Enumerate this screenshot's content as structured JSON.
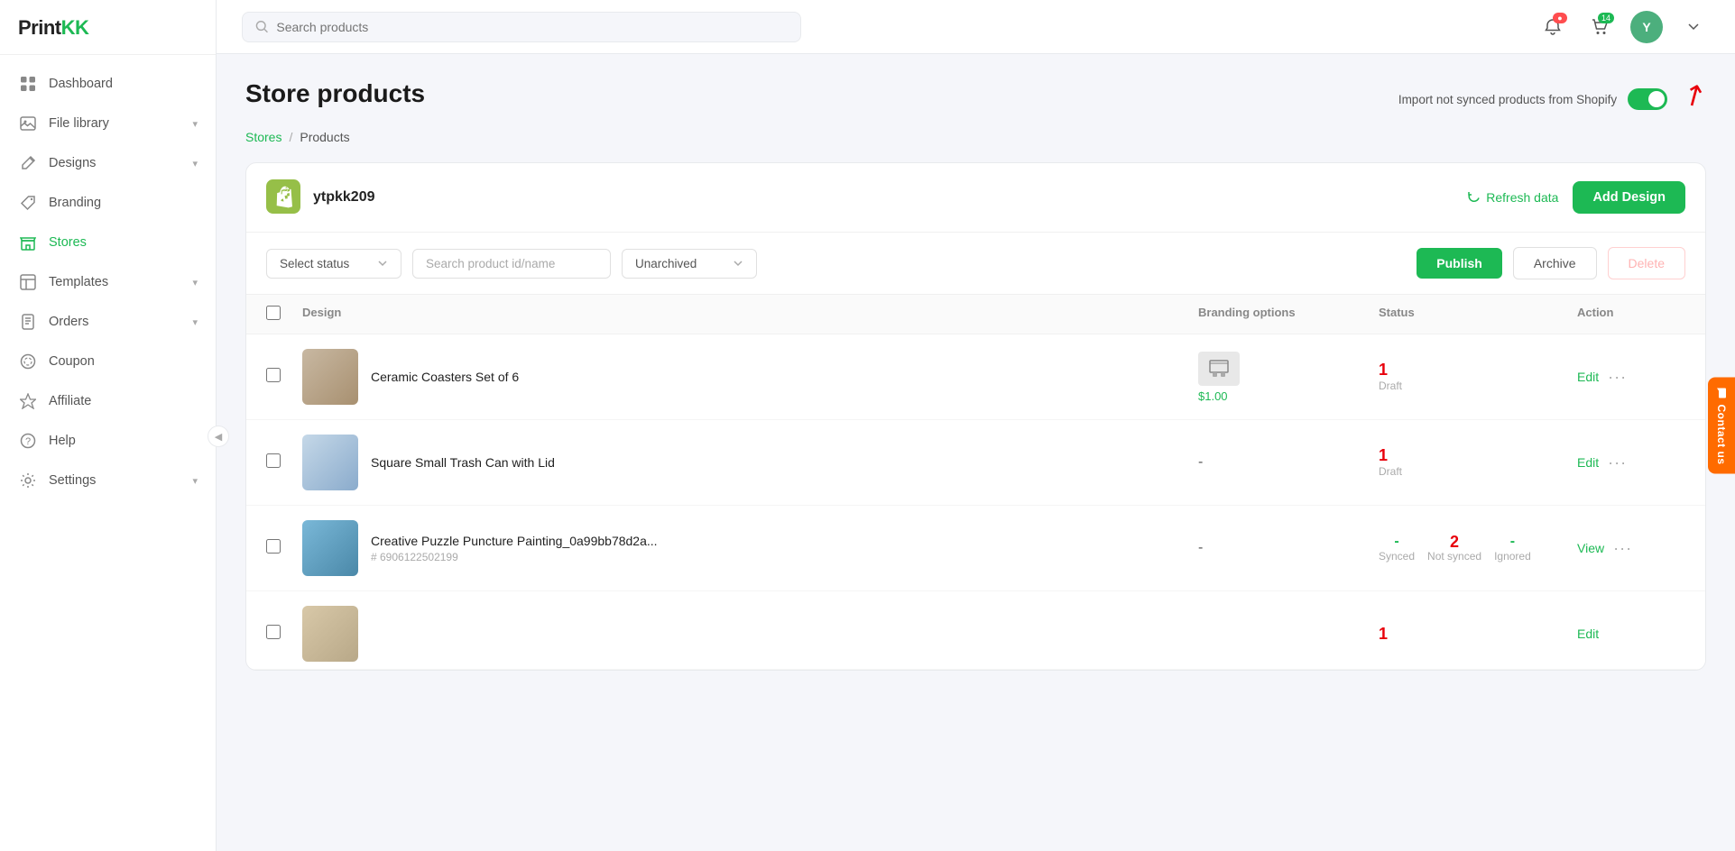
{
  "sidebar": {
    "logo": {
      "print": "Print",
      "kk": "KK"
    },
    "items": [
      {
        "id": "dashboard",
        "label": "Dashboard",
        "icon": "grid",
        "hasArrow": false
      },
      {
        "id": "file-library",
        "label": "File library",
        "icon": "image",
        "hasArrow": true
      },
      {
        "id": "designs",
        "label": "Designs",
        "icon": "pen",
        "hasArrow": true
      },
      {
        "id": "branding",
        "label": "Branding",
        "icon": "tag",
        "hasArrow": false
      },
      {
        "id": "stores",
        "label": "Stores",
        "icon": "store",
        "hasArrow": false,
        "active": true
      },
      {
        "id": "templates",
        "label": "Templates",
        "icon": "template",
        "hasArrow": true
      },
      {
        "id": "orders",
        "label": "Orders",
        "icon": "orders",
        "hasArrow": true
      },
      {
        "id": "coupon",
        "label": "Coupon",
        "icon": "coupon",
        "hasArrow": false
      },
      {
        "id": "affiliate",
        "label": "Affiliate",
        "icon": "affiliate",
        "hasArrow": false
      },
      {
        "id": "help",
        "label": "Help",
        "icon": "help",
        "hasArrow": false
      },
      {
        "id": "settings",
        "label": "Settings",
        "icon": "settings",
        "hasArrow": true
      }
    ]
  },
  "topbar": {
    "search_placeholder": "Search products",
    "cart_badge": "14",
    "user_initials": "Y"
  },
  "page": {
    "title": "Store products",
    "import_label": "Import not synced products from Shopify",
    "breadcrumb": {
      "stores": "Stores",
      "separator": "/",
      "current": "Products"
    }
  },
  "store": {
    "name": "ytpkk209",
    "refresh_label": "Refresh data",
    "add_design_label": "Add Design"
  },
  "filters": {
    "status_placeholder": "Select status",
    "search_placeholder": "Search product id/name",
    "archive_default": "Unarchived",
    "publish_label": "Publish",
    "archive_label": "Archive",
    "delete_label": "Delete"
  },
  "table": {
    "headers": [
      "",
      "Design",
      "Branding options",
      "Status",
      "Action"
    ],
    "rows": [
      {
        "id": "row1",
        "name": "Ceramic Coasters Set of 6",
        "product_id": "",
        "branding_price": "$1.00",
        "has_branding": true,
        "status_num": "1",
        "status_label": "Draft",
        "action": "Edit",
        "show_synced": false,
        "image_class": "img-coaster"
      },
      {
        "id": "row2",
        "name": "Square Small Trash Can with Lid",
        "product_id": "",
        "branding_price": "",
        "has_branding": false,
        "branding_dash": "-",
        "status_num": "1",
        "status_label": "Draft",
        "action": "Edit",
        "show_synced": false,
        "image_class": "img-trash"
      },
      {
        "id": "row3",
        "name": "Creative Puzzle Puncture Painting_0a99bb78d2a...",
        "product_id": "# 6906122502199",
        "branding_price": "",
        "has_branding": false,
        "branding_dash": "-",
        "synced_dash": "-",
        "synced_label": "Synced",
        "not_synced_num": "2",
        "not_synced_label": "Not synced",
        "ignored_dash": "-",
        "ignored_label": "Ignored",
        "action": "View",
        "show_synced": true,
        "image_class": "img-puzzle"
      },
      {
        "id": "row4",
        "name": "...",
        "product_id": "",
        "status_num": "1",
        "status_label": "",
        "action": "Edit",
        "show_synced": false,
        "image_class": "img-partial",
        "partial": true
      }
    ]
  },
  "contact_us": "Contact us"
}
